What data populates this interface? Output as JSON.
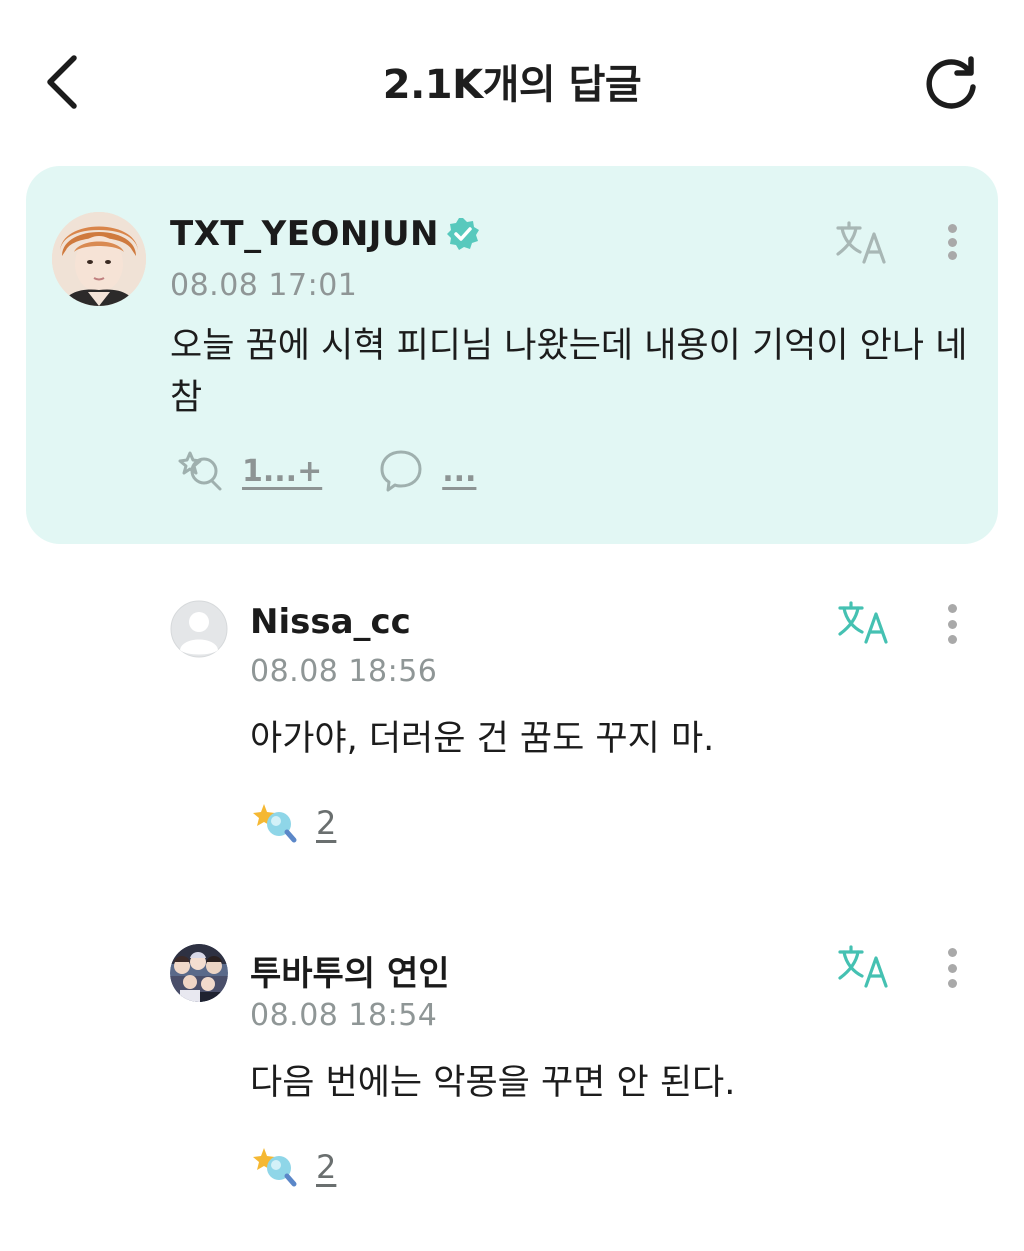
{
  "header": {
    "title": "2.1K개의 답글",
    "back_icon": "chevron-left-icon",
    "refresh_icon": "refresh-icon"
  },
  "post": {
    "username": "TXT_YEONJUN",
    "verified": true,
    "timestamp": "08.08 17:01",
    "text": "오늘 꿈에 시혁 피디님 나왔는데 내용이 기억이 안나 네 참",
    "like_count": "1...+",
    "comment_count": "...",
    "background_color": "#e2f7f4",
    "verified_color": "#58c9bd"
  },
  "replies": [
    {
      "username": "Nissa_cc",
      "timestamp": "08.08 18:56",
      "text": "아가야, 더러운 건 꿈도 꾸지 마.",
      "like_count": "2",
      "avatar": "default-avatar"
    },
    {
      "username": "투바투의 연인",
      "timestamp": "08.08 18:54",
      "text": "다음 번에는 악몽을 꾸면 안 된다.",
      "like_count": "2",
      "avatar": "group-photo-avatar"
    }
  ],
  "colors": {
    "accent": "#45c1b2",
    "muted": "#8f9696"
  }
}
